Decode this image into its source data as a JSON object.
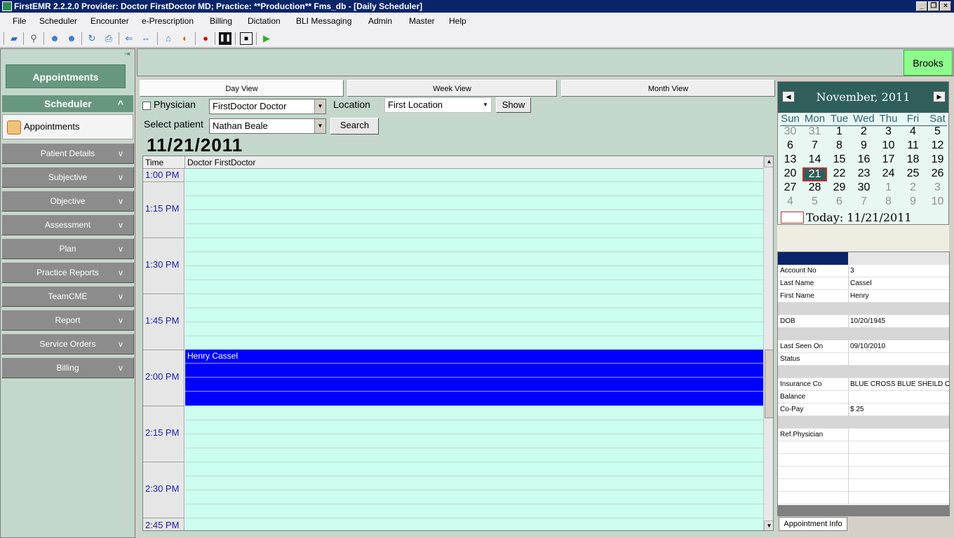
{
  "window": {
    "title": "FirstEMR 2.2.2.0 Provider: Doctor FirstDoctor MD; Practice: **Production** Fms_db - [Daily Scheduler]"
  },
  "menu": [
    "File",
    "Scheduler",
    "Encounter",
    "e-Prescription",
    "Billing",
    "Dictation",
    "BLI Messaging",
    "Admin",
    "Master",
    "Help"
  ],
  "sidebar": {
    "appointments_header": "Appointments",
    "scheduler_header": "Scheduler",
    "scheduler_item": "Appointments",
    "sections": [
      "Patient Details",
      "Subjective",
      "Objective",
      "Assessment",
      "Plan",
      "Practice Reports",
      "TeamCME",
      "Report",
      "Service Orders",
      "Billing"
    ],
    "chevron": "v",
    "collapse": "^"
  },
  "topstrip": {
    "user_button": "Brooks"
  },
  "views": {
    "day": "Day View",
    "week": "Week View",
    "month": "Month View"
  },
  "filters": {
    "physician_label": "Physician",
    "physician_value": "FirstDoctor Doctor",
    "location_label": "Location",
    "location_value": "First Location",
    "show_button": "Show",
    "patient_label": "Select patient",
    "patient_value": "Nathan Beale",
    "search_button": "Search"
  },
  "schedule": {
    "date": "11/21/2011",
    "time_header": "Time",
    "doctor_header": "Doctor FirstDoctor",
    "time_labels": [
      "1:00 PM",
      "1:15 PM",
      "1:30 PM",
      "1:45 PM",
      "2:00 PM",
      "2:15 PM",
      "2:30 PM",
      "2:45 PM"
    ],
    "appointment": {
      "patient": "Henry Cassel"
    }
  },
  "calendar": {
    "month_year": "November, 2011",
    "weekdays": [
      "Sun",
      "Mon",
      "Tue",
      "Wed",
      "Thu",
      "Fri",
      "Sat"
    ],
    "weeks": [
      [
        "30",
        "31",
        "1",
        "2",
        "3",
        "4",
        "5"
      ],
      [
        "6",
        "7",
        "8",
        "9",
        "10",
        "11",
        "12"
      ],
      [
        "13",
        "14",
        "15",
        "16",
        "17",
        "18",
        "19"
      ],
      [
        "20",
        "21",
        "22",
        "23",
        "24",
        "25",
        "26"
      ],
      [
        "27",
        "28",
        "29",
        "30",
        "1",
        "2",
        "3"
      ],
      [
        "4",
        "5",
        "6",
        "7",
        "8",
        "9",
        "10"
      ]
    ],
    "selected_day": "21",
    "today_label": "Today: 11/21/2011",
    "colors": {
      "header": "#2e5f5b",
      "selected": "#2e5f5b",
      "other_month": "#909090"
    }
  },
  "patient_info": {
    "rows": [
      {
        "key": "Account No",
        "value": "3"
      },
      {
        "key": "Last Name",
        "value": "Cassel"
      },
      {
        "key": "First Name",
        "value": "Henry"
      },
      {
        "key": "",
        "value": ""
      },
      {
        "key": "DOB",
        "value": "10/20/1945"
      },
      {
        "key": "",
        "value": ""
      },
      {
        "key": "Last Seen On",
        "value": "09/10/2010"
      },
      {
        "key": "Status",
        "value": ""
      },
      {
        "key": "",
        "value": ""
      },
      {
        "key": "Insurance Co",
        "value": "BLUE CROSS BLUE SHEILD OF"
      },
      {
        "key": "Balance",
        "value": ""
      },
      {
        "key": "Co-Pay",
        "value": "$ 25"
      },
      {
        "key": "",
        "value": ""
      },
      {
        "key": "Ref.Physician",
        "value": ""
      }
    ],
    "tab": "Appointment Info"
  },
  "colors": {
    "appointment": "#0000ff",
    "slot_bg": "#ccfff0",
    "panel_bg": "#c3d8cb",
    "time_text": "#1a1aa8"
  }
}
